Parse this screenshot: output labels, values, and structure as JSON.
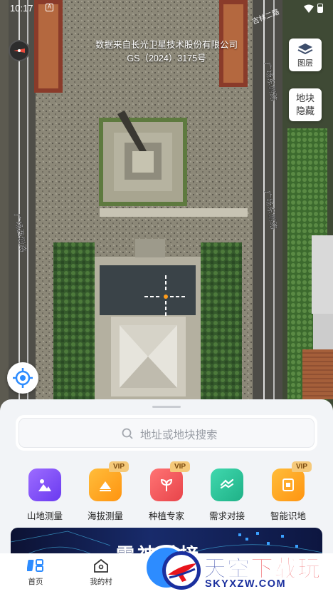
{
  "status_bar": {
    "time": "10:17",
    "notif_badge": "A"
  },
  "map": {
    "copyright_line1": "数据来自长光卫星技术股份有限公司",
    "copyright_line2": "GS（2024）3175号",
    "road_labels": [
      "广场东侧路",
      "广场西侧路",
      "广场东侧路",
      "吉林二路"
    ]
  },
  "controls": {
    "layers_label": "图层",
    "plot_line1": "地块",
    "plot_line2": "隐藏"
  },
  "search": {
    "placeholder": "地址或地块搜索"
  },
  "tools": [
    {
      "label": "山地测量",
      "vip": false,
      "color": "#7a4cf5"
    },
    {
      "label": "海拔测量",
      "vip": true,
      "vip_text": "VIP",
      "color": "#ffa51e"
    },
    {
      "label": "种植专家",
      "vip": true,
      "vip_text": "VIP",
      "color": "#f0555a"
    },
    {
      "label": "需求对接",
      "vip": false,
      "color": "#2fc59a"
    },
    {
      "label": "智能识地",
      "vip": true,
      "vip_text": "VIP",
      "color": "#ffa51e"
    }
  ],
  "banner": {
    "text": "雷神对接"
  },
  "tabbar": {
    "home": "首页",
    "village": "我的村"
  },
  "watermark": {
    "title_part1": "天空",
    "title_part2": "下载玩",
    "url": "SKYXZW.COM"
  },
  "colors": {
    "accent": "#2d8cff",
    "sheet_bg": "#f2f4f7"
  }
}
